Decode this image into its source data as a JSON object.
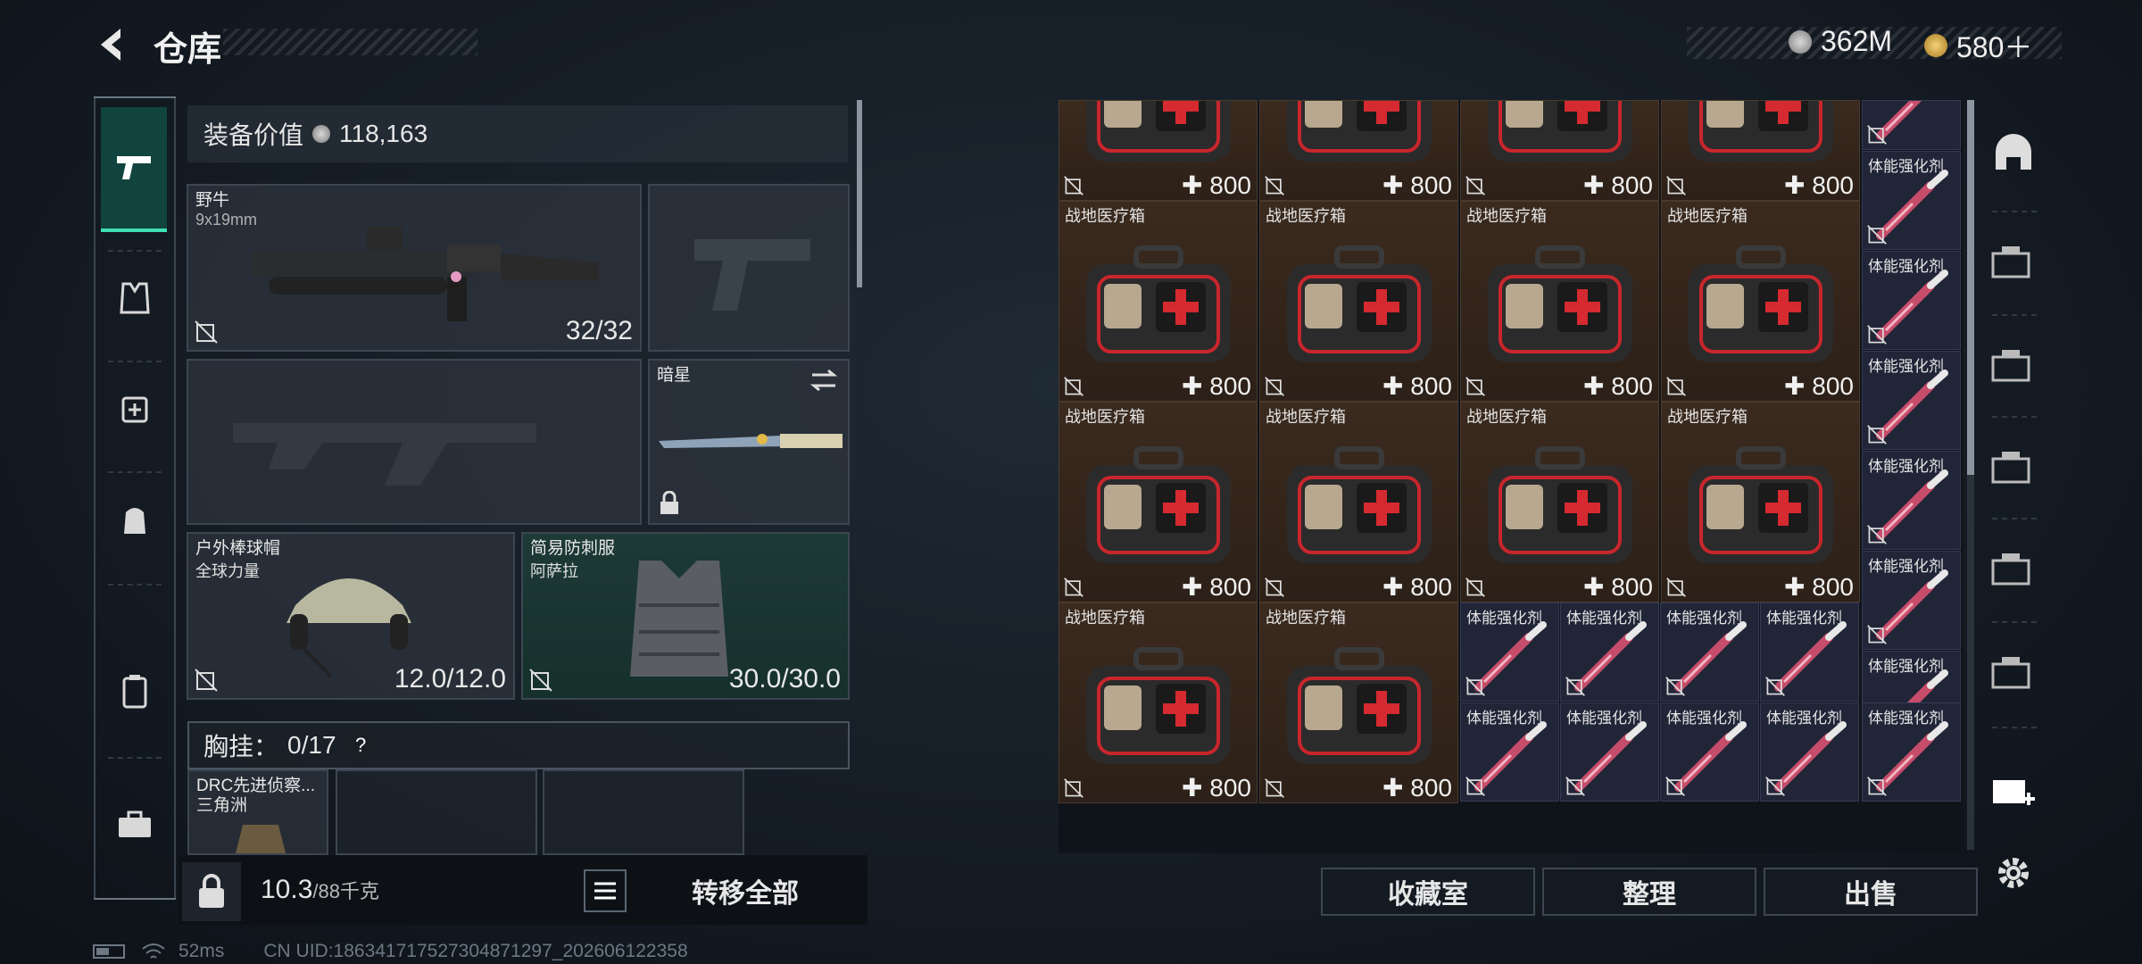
{
  "header": {
    "title": "仓库"
  },
  "currency": [
    {
      "value": "362M"
    },
    {
      "value": "580＋"
    }
  ],
  "equipment_value": {
    "label": "装备价值",
    "value": "118,163"
  },
  "primary_weapon": {
    "name": "野牛",
    "caliber": "9x19mm",
    "ammo": "32/32"
  },
  "melee": {
    "name": "暗星"
  },
  "helmet": {
    "name": "户外棒球帽",
    "faction": "全球力量",
    "durability": "12.0/12.0"
  },
  "armor": {
    "name": "简易防刺服",
    "faction": "阿萨拉",
    "durability": "30.0/30.0"
  },
  "chest_rig": {
    "label": "胸挂：",
    "count": "0/17",
    "help": "?"
  },
  "backpack": {
    "name": "DRC先进侦察...",
    "faction": "三角洲"
  },
  "weight": {
    "current": "10.3",
    "max": "/88千克"
  },
  "transfer_all": "转移全部",
  "status": {
    "ping": "52ms",
    "uid": "CN UID:18634171752730487129​7_202606122358"
  },
  "items": {
    "medkit_name": "战地医疗箱",
    "medkit_hp": "800",
    "stim_name": "体能强化剂"
  },
  "bottom_buttons": [
    "收藏室",
    "整理",
    "出售"
  ],
  "colors": {
    "accent": "#3fe0b2",
    "medkit_red": "#c8262c"
  }
}
